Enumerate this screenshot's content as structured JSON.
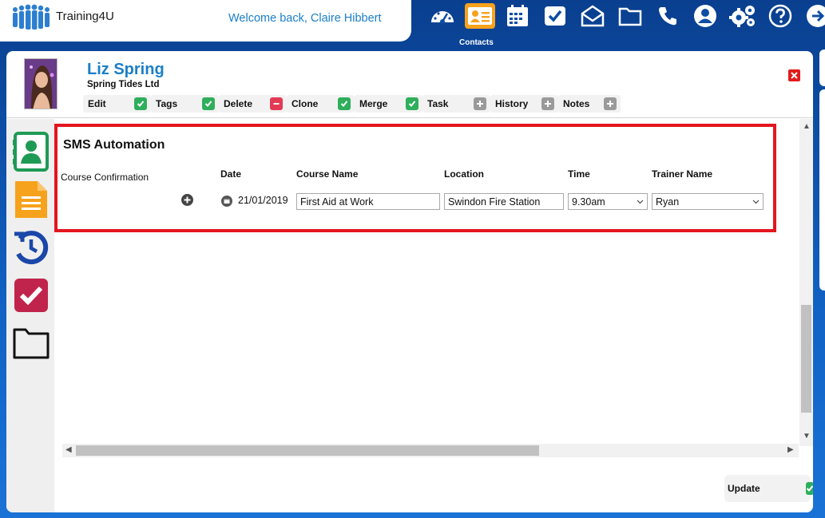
{
  "brand": {
    "name": "Training4U"
  },
  "header": {
    "welcome": "Welcome back, Claire Hibbert"
  },
  "nav": {
    "items": [
      "dashboard-icon",
      "contacts-icon",
      "calendar-icon",
      "tasks-icon",
      "mail-icon",
      "folder-icon",
      "phone-icon",
      "user-icon",
      "settings-icon",
      "help-icon",
      "logout-icon"
    ],
    "active_label": "Contacts"
  },
  "contact": {
    "name": "Liz Spring",
    "company": "Spring Tides Ltd"
  },
  "actions": [
    {
      "label": "Edit",
      "badge": "check"
    },
    {
      "label": "Tags",
      "badge": "check"
    },
    {
      "label": "Delete",
      "badge": "minus"
    },
    {
      "label": "Clone",
      "badge": "check"
    },
    {
      "label": "Merge",
      "badge": "check"
    },
    {
      "label": "Task",
      "badge": "plus"
    },
    {
      "label": "History",
      "badge": "plus"
    },
    {
      "label": "Notes",
      "badge": "plus"
    }
  ],
  "sms": {
    "title": "SMS Automation",
    "row_label": "Course Confirmation",
    "columns": {
      "date": "Date",
      "course": "Course Name",
      "location": "Location",
      "time": "Time",
      "trainer": "Trainer Name"
    },
    "date": "21/01/2019",
    "course": "First Aid at Work",
    "location": "Swindon Fire Station",
    "time": "9.30am",
    "trainer": "Ryan"
  },
  "update_label": "Update",
  "colors": {
    "accent": "#1b7fc7",
    "active_nav": "#f7a21c",
    "highlight": "#e3161e",
    "green": "#2fae5c"
  }
}
